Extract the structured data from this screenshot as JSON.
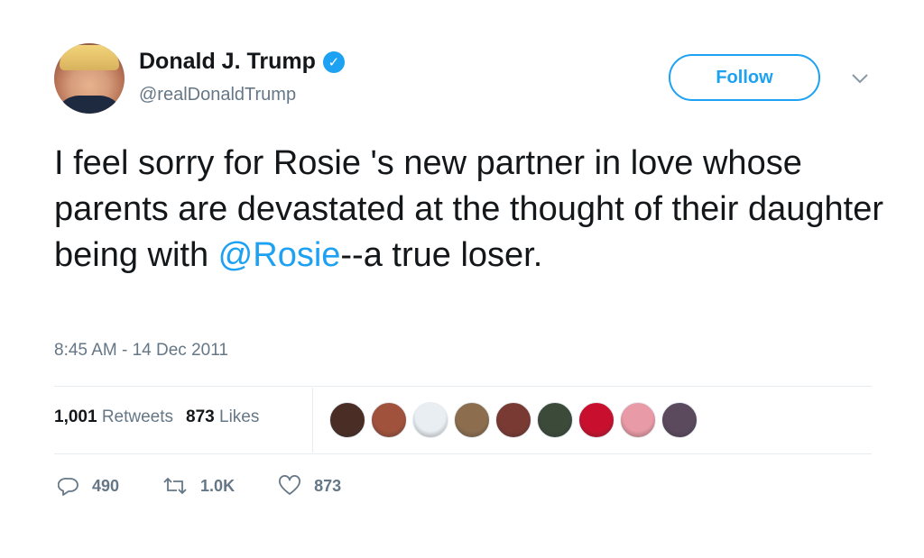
{
  "user": {
    "name": "Donald J. Trump",
    "handle": "@realDonaldTrump",
    "verified_mark": "✓"
  },
  "follow_button": {
    "label": "Follow"
  },
  "tweet": {
    "text_before": "I feel sorry for Rosie 's new partner in love whose parents are devastated at the thought of their daughter being with ",
    "mention": "@Rosie",
    "text_after": "--a true loser.",
    "timestamp": "8:45 AM - 14 Dec 2011"
  },
  "stats": {
    "retweets_count": "1,001",
    "retweets_label": "Retweets",
    "likes_count": "873",
    "likes_label": "Likes"
  },
  "likers": [
    {
      "icon": "liker-avatar",
      "color": "#4a2e26"
    },
    {
      "icon": "liker-avatar",
      "color": "#a0523d"
    },
    {
      "icon": "liker-avatar",
      "color": "#e9eef2"
    },
    {
      "icon": "liker-avatar",
      "color": "#8c6e4f"
    },
    {
      "icon": "liker-avatar",
      "color": "#7a3a34"
    },
    {
      "icon": "liker-avatar",
      "color": "#3c4a3a"
    },
    {
      "icon": "liker-avatar",
      "color": "#c8102e"
    },
    {
      "icon": "liker-avatar",
      "color": "#e89aa6"
    },
    {
      "icon": "liker-avatar",
      "color": "#5b4a5e"
    }
  ],
  "actions": {
    "replies": "490",
    "retweets": "1.0K",
    "likes": "873"
  },
  "colors": {
    "accent": "#1da1f2",
    "muted": "#657786",
    "text": "#14171a",
    "divider": "#e6ecf0"
  }
}
